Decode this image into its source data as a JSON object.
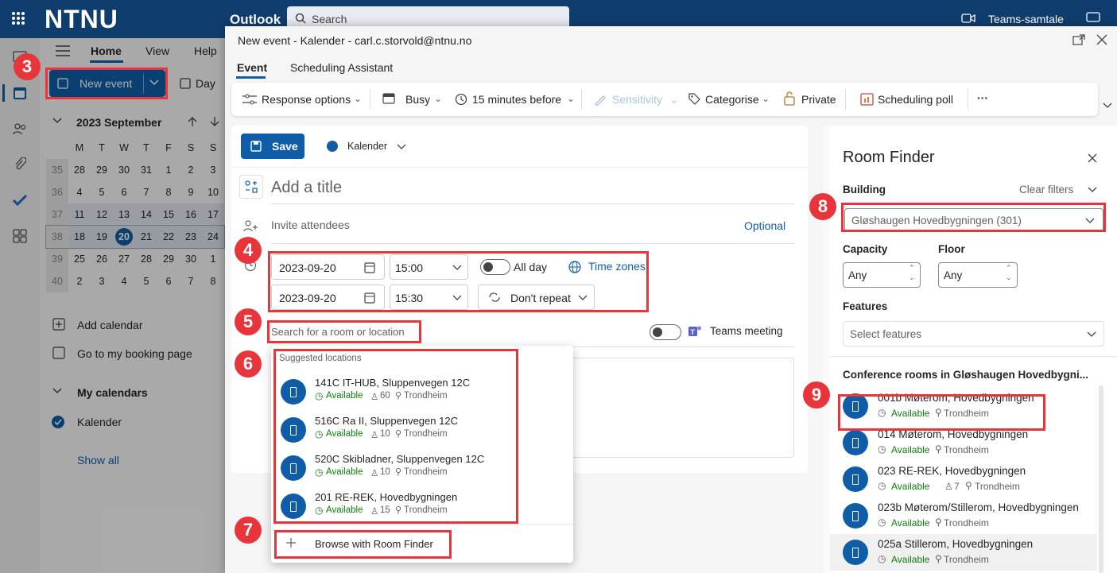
{
  "topbar": {
    "logo": "NTNU",
    "app": "Outlook",
    "search_placeholder": "Search",
    "teams": "Teams-samtale"
  },
  "ribbon_tabs": [
    "Home",
    "View",
    "Help"
  ],
  "new_event": "New event",
  "day": "Day",
  "month": "2023 September",
  "weekdays": [
    "M",
    "T",
    "W",
    "T",
    "F",
    "S",
    "S"
  ],
  "weeks": [
    {
      "wk": "35",
      "days": [
        "28",
        "29",
        "30",
        "31",
        "1",
        "2",
        "3"
      ]
    },
    {
      "wk": "36",
      "days": [
        "4",
        "5",
        "6",
        "7",
        "8",
        "9",
        "10"
      ]
    },
    {
      "wk": "37",
      "days": [
        "11",
        "12",
        "13",
        "14",
        "15",
        "16",
        "17"
      ]
    },
    {
      "wk": "38",
      "days": [
        "18",
        "19",
        "20",
        "21",
        "22",
        "23",
        "24"
      ]
    },
    {
      "wk": "39",
      "days": [
        "25",
        "26",
        "27",
        "28",
        "29",
        "30",
        "1"
      ]
    },
    {
      "wk": "40",
      "days": [
        "2",
        "3",
        "4",
        "5",
        "6",
        "7",
        "8"
      ]
    }
  ],
  "today": "20",
  "sidebar_links": {
    "add_calendar": "Add calendar",
    "booking": "Go to my booking page",
    "my_calendars": "My calendars",
    "kalender": "Kalender",
    "show_all": "Show all"
  },
  "dialog": {
    "title": "New event - Kalender - carl.c.storvold@ntnu.no",
    "tabs": [
      "Event",
      "Scheduling Assistant"
    ]
  },
  "toolbar": {
    "response": "Response options",
    "busy": "Busy",
    "reminder": "15 minutes before",
    "sensitivity": "Sensitivity",
    "categorise": "Categorise",
    "private": "Private",
    "poll": "Scheduling poll",
    "more": "···"
  },
  "form": {
    "save": "Save",
    "calendar": "Kalender",
    "title_placeholder": "Add a title",
    "invite": "Invite attendees",
    "optional": "Optional",
    "start_date": "2023-09-20",
    "start_time": "15:00",
    "all_day": "All day",
    "timezones": "Time zones",
    "end_date": "2023-09-20",
    "end_time": "15:30",
    "repeat": "Don't repeat",
    "location_placeholder": "Search for a room or location",
    "teams": "Teams meeting"
  },
  "suggestions": {
    "header": "Suggested locations",
    "browse": "Browse with Room Finder",
    "items": [
      {
        "name": "141C IT-HUB, Sluppenvegen 12C",
        "status": "Available",
        "cap": "60",
        "city": "Trondheim"
      },
      {
        "name": "516C Ra II, Sluppenvegen 12C",
        "status": "Available",
        "cap": "10",
        "city": "Trondheim"
      },
      {
        "name": "520C Skibladner, Sluppenvegen 12C",
        "status": "Available",
        "cap": "10",
        "city": "Trondheim"
      },
      {
        "name": "201 RE-REK, Hovedbygningen",
        "status": "Available",
        "cap": "15",
        "city": "Trondheim"
      }
    ]
  },
  "room_finder": {
    "title": "Room Finder",
    "building_label": "Building",
    "clear": "Clear filters",
    "building": "Gløshaugen Hovedbygningen (301)",
    "capacity_label": "Capacity",
    "floor_label": "Floor",
    "capacity": "Any",
    "floor": "Any",
    "features_label": "Features",
    "features_placeholder": "Select features",
    "section": "Conference rooms in Gløshaugen Hovedbygni...",
    "rooms": [
      {
        "name": "001b Møterom, Hovedbygningen",
        "status": "Available",
        "cap": "",
        "city": "Trondheim"
      },
      {
        "name": "014 Møterom, Hovedbygningen",
        "status": "Available",
        "cap": "",
        "city": "Trondheim"
      },
      {
        "name": "023 RE-REK, Hovedbygningen",
        "status": "Available",
        "cap": "7",
        "city": "Trondheim"
      },
      {
        "name": "023b Møterom/Stillerom, Hovedbygningen",
        "status": "Available",
        "cap": "",
        "city": "Trondheim"
      },
      {
        "name": "025a Stillerom, Hovedbygningen",
        "status": "Available",
        "cap": "",
        "city": "Trondheim"
      }
    ]
  },
  "badges": {
    "b3": "3",
    "b4": "4",
    "b5": "5",
    "b6": "6",
    "b7": "7",
    "b8": "8",
    "b9": "9"
  }
}
